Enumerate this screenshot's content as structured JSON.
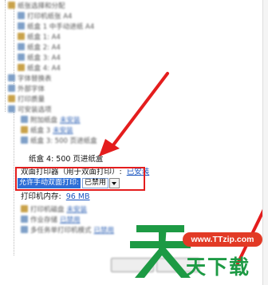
{
  "blur_rows": [
    {
      "label": "纸张选择和分配",
      "value": ""
    },
    {
      "label": "打印机纸张 A4",
      "value": ""
    },
    {
      "label": "纸盒 1 中手动进纸 A4",
      "value": ""
    },
    {
      "label": "纸盒 1: A4",
      "value": ""
    },
    {
      "label": "纸盒 2: A4",
      "value": ""
    },
    {
      "label": "纸盒 3: A4",
      "value": ""
    },
    {
      "label": "纸盒 4: A4",
      "value": ""
    },
    {
      "label": "字体替换表",
      "value": ""
    },
    {
      "label": "外部字体",
      "value": ""
    },
    {
      "label": "打印质量",
      "value": ""
    },
    {
      "label": "可安装选项",
      "value": ""
    },
    {
      "label": "附加纸盘",
      "value": "未安装"
    },
    {
      "label": "纸盒 3",
      "value": "未安装"
    },
    {
      "label": "纸盒 3: 500 页进纸盒",
      "value": ""
    }
  ],
  "sharp_rows": [
    {
      "label": "纸盒 4: 500 页进纸盒",
      "value": ""
    },
    {
      "label": "双面打印器（用于双面打印）:",
      "value": "已安装"
    }
  ],
  "setting": {
    "label": "允许手动双面打印:",
    "selected": "已禁用"
  },
  "memory_row": {
    "label": "打印机内存:",
    "value": "96 MB"
  },
  "blur_rows_after": [
    {
      "label": "打印机磁盘",
      "value": "未安装"
    },
    {
      "label": "作业存储",
      "value": "已禁用"
    },
    {
      "label": "多任务单打印机模式",
      "value": "已禁用"
    }
  ],
  "watermark": {
    "site": "www.TTzip.com",
    "text": "天下载"
  },
  "colors": {
    "highlight_border": "#e41d1d",
    "selection_blue": "#2f6fd6",
    "arrow_red": "#e41d1d",
    "brand_green": "#1d9a44"
  }
}
